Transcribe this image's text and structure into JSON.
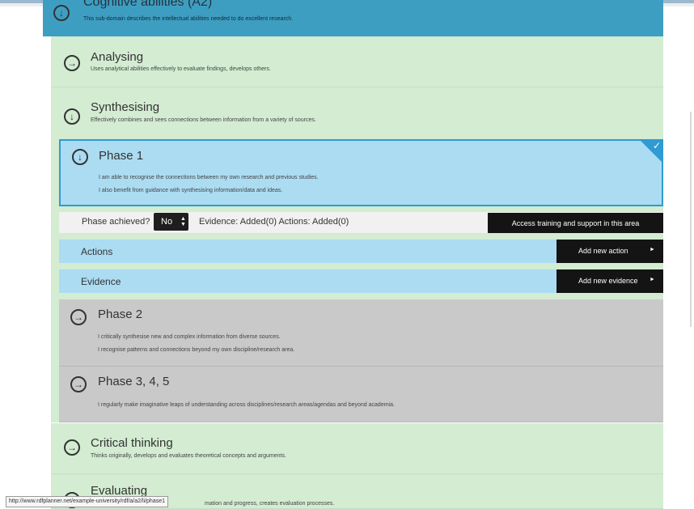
{
  "header": {
    "title": "Cognitive abilities (A2)",
    "desc": "This sub-domain describes the intellectual abilities needed to do excellent research."
  },
  "items": {
    "analysing": {
      "title": "Analysing",
      "desc": "Uses analytical abilities effectively to evaluate findings, develops others."
    },
    "synthesising": {
      "title": "Synthesising",
      "desc": "Effectively combines and sees connections between information from a variety of sources."
    },
    "critical": {
      "title": "Critical thinking",
      "desc": "Thinks originally, develops and evaluates theoretical concepts and arguments."
    },
    "evaluating": {
      "title": "Evaluating",
      "desc": "mation and progress, creates evaluation processes."
    }
  },
  "phase1": {
    "title": "Phase 1",
    "lines": [
      "I am able to recognise the connections between my own research and previous studies.",
      "I also benefit from guidance with synthesising information/data and ideas."
    ],
    "checked": true
  },
  "status": {
    "achieved_label": "Phase achieved?",
    "achieved_value": "No",
    "evidence_text": "Evidence: Added(0) Actions: Added(0)",
    "training_button": "Access training and support in this area"
  },
  "actions": {
    "label": "Actions",
    "button": "Add new action"
  },
  "evidence": {
    "label": "Evidence",
    "button": "Add new evidence"
  },
  "phase2": {
    "title": "Phase 2",
    "lines": [
      "I critically synthesise new and complex information from diverse sources.",
      "I recognise patterns and connections beyond my own discipline/research area."
    ]
  },
  "phase345": {
    "title": "Phase 3, 4, 5",
    "lines": [
      "I regularly make imaginative leaps of understanding across disciplines/research areas/agendas and beyond academia."
    ]
  },
  "statusbar": {
    "url": "http://www.rdfplanner.net/example-university/rdf/a/a2/li/phase1"
  },
  "colors": {
    "header_blue": "#3e9ec2",
    "item_green": "#d3ecd2",
    "phase_blue": "#abdcf2",
    "phase_border": "#2f9ad3",
    "phase_grey": "#c9c9c9",
    "button_black": "#141414"
  },
  "icons": {
    "collapse": "arrow-down-circle-icon",
    "expand": "arrow-right-circle-icon",
    "check": "check-icon",
    "select_arrows": "updown-arrows-icon",
    "button_arrow": "play-right-icon"
  }
}
